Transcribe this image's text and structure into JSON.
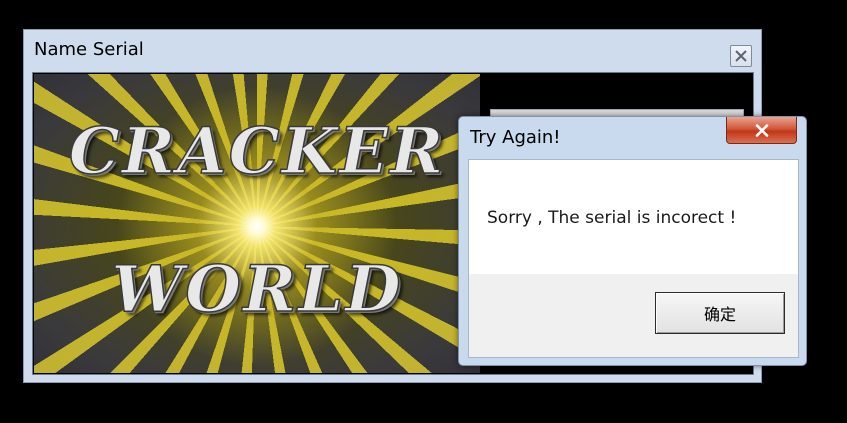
{
  "main_window": {
    "title": "Name Serial",
    "close_icon": "close-icon",
    "banner": {
      "line1": "CRACKER",
      "line2": "WORLD"
    }
  },
  "dialog": {
    "title": "Try Again!",
    "close_icon": "close-icon",
    "message": "Sorry , The serial is incorect !",
    "ok_label": "确定"
  },
  "colors": {
    "title_bar": "#cfdced",
    "dialog_close": "#c9432a",
    "dialog_footer": "#f0f0f0"
  }
}
